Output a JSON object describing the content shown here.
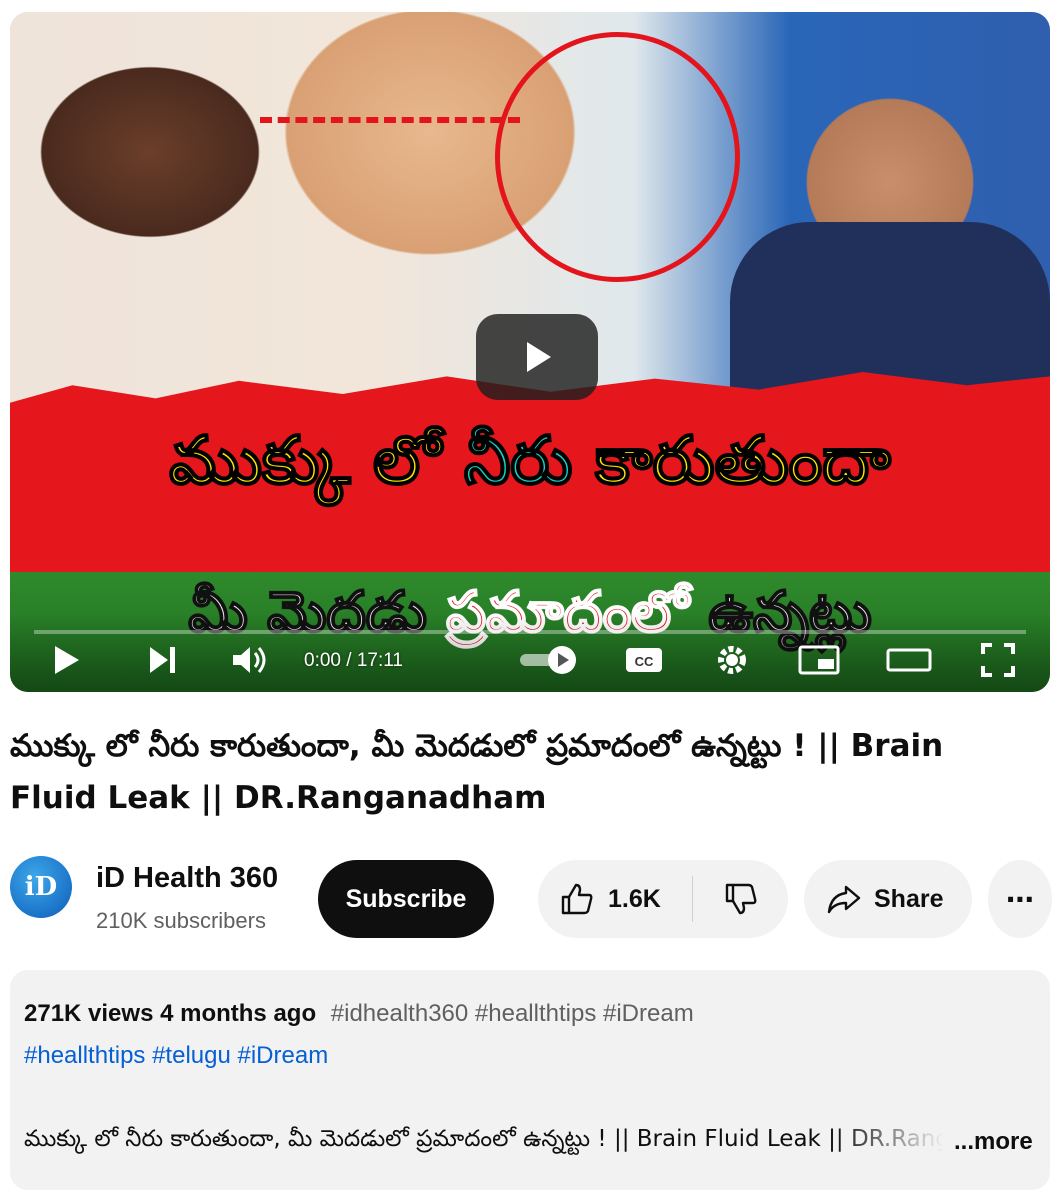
{
  "player": {
    "thumbnail": {
      "headline_part1": "ముక్కు లో ",
      "headline_part2": "నీరు",
      "headline_part3": " కారుతుందా",
      "subline_part1": "మీ మెదడు ",
      "subline_part2": "ప్రమాదంలో",
      "subline_part3": " ఉన్నట్లు"
    },
    "time_current": "0:00",
    "time_separator": " / ",
    "time_total": "17:11"
  },
  "video": {
    "title": "ముక్కు లో నీరు కారుతుందా, మీ మెదడులో ప్రమాదంలో ఉన్నట్టు ! || Brain Fluid Leak || DR.Ranganadham"
  },
  "channel": {
    "avatar_text": "iD",
    "name": "iD Health 360",
    "subscribers": "210K subscribers",
    "subscribe_label": "Subscribe"
  },
  "actions": {
    "like_count": "1.6K",
    "share_label": "Share",
    "more_label": "⋯"
  },
  "description": {
    "views": "271K views",
    "ago": "4 months ago",
    "inline_tags": "#idhealth360 #heallthtips #iDream",
    "tags_line": "#heallthtips #telugu #iDream",
    "text": "ముక్కు లో నీరు కారుతుందా, మీ మెదడులో ప్రమాదంలో ఉన్నట్టు ! || Brain Fluid Leak || DR.Ranganadham",
    "more_label": "...more"
  },
  "colors": {
    "subscribe_bg": "#0f0f0f",
    "pill_bg": "#f2f2f2",
    "link_blue": "#065fd4",
    "banner_red": "#e5161c",
    "headline_yellow": "#ffe600",
    "headline_teal": "#17d3c0"
  },
  "icons": [
    "play-icon",
    "next-icon",
    "volume-icon",
    "autoplay-toggle-icon",
    "captions-icon",
    "settings-icon",
    "miniplayer-icon",
    "theater-icon",
    "fullscreen-icon",
    "thumbs-up-icon",
    "thumbs-down-icon",
    "share-arrow-icon",
    "more-dots-icon"
  ]
}
